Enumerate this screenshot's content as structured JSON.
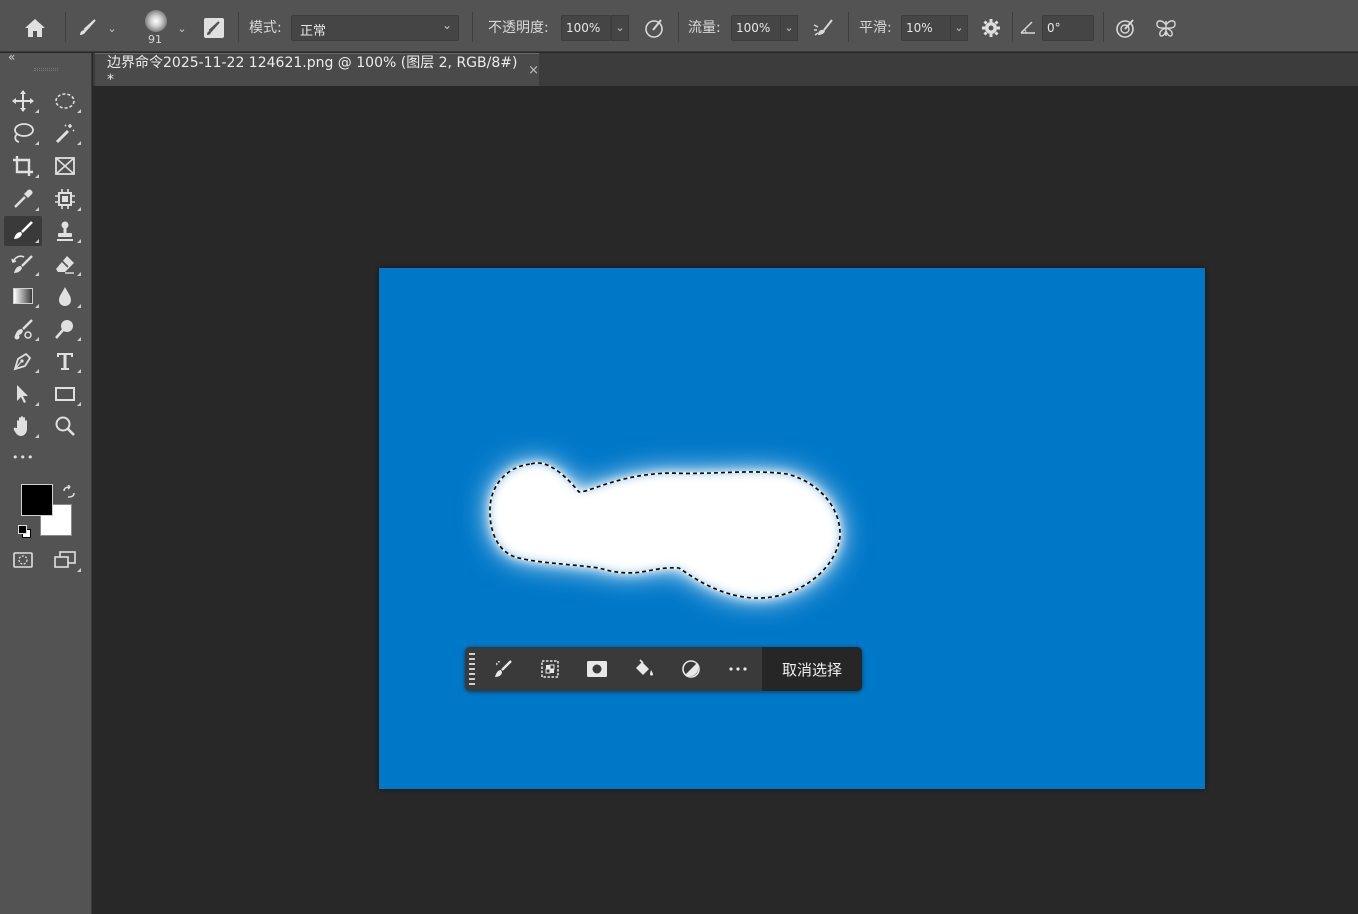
{
  "options_bar": {
    "brush_size": "91",
    "mode_label": "模式:",
    "mode_value": "正常",
    "opacity_label": "不透明度:",
    "opacity_value": "100%",
    "flow_label": "流量:",
    "flow_value": "100%",
    "smoothing_label": "平滑:",
    "smoothing_value": "10%",
    "angle_value": "0°"
  },
  "tab": {
    "title": "边界命令2025-11-22 124621.png @ 100% (图层 2, RGB/8#) *",
    "close": "×"
  },
  "toolbar": {
    "collapse_label": "«",
    "more_label": "•••",
    "foreground_color": "#000000",
    "background_color": "#ffffff"
  },
  "canvas": {
    "background_color": "#0078c8"
  },
  "context_bar": {
    "deselect_label": "取消选择"
  }
}
